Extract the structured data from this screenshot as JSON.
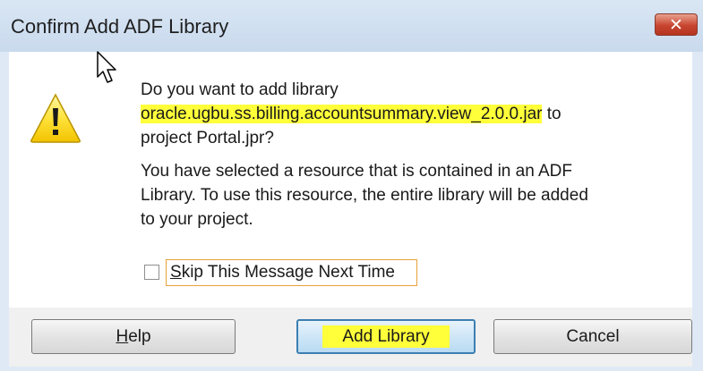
{
  "dialog": {
    "title": "Confirm Add ADF Library",
    "close_glyph": "✕"
  },
  "message": {
    "line1": "Do you want to add library",
    "library_name": "oracle.ugbu.ss.billing.accountsummary.view_2.0.0.jar",
    "line2_suffix": " to",
    "line3": "project Portal.jpr?",
    "detail_line1": "You have selected a resource that is contained in an ADF",
    "detail_line2": "Library. To use this resource, the entire library will be added",
    "detail_line3": "to your project."
  },
  "checkbox": {
    "mnemonic": "S",
    "label_rest": "kip This Message Next Time",
    "checked": false
  },
  "buttons": {
    "help_mnemonic": "H",
    "help_rest": "elp",
    "add_library": "Add Library",
    "cancel": "Cancel"
  },
  "icons": {
    "warning": "warning-icon",
    "cursor": "mouse-pointer-icon",
    "close": "close-icon"
  },
  "colors": {
    "highlight": "#ffff3a",
    "close_button": "#c7452f",
    "default_button_border": "#3c7fb1",
    "focus_outline": "#e8a13a"
  }
}
